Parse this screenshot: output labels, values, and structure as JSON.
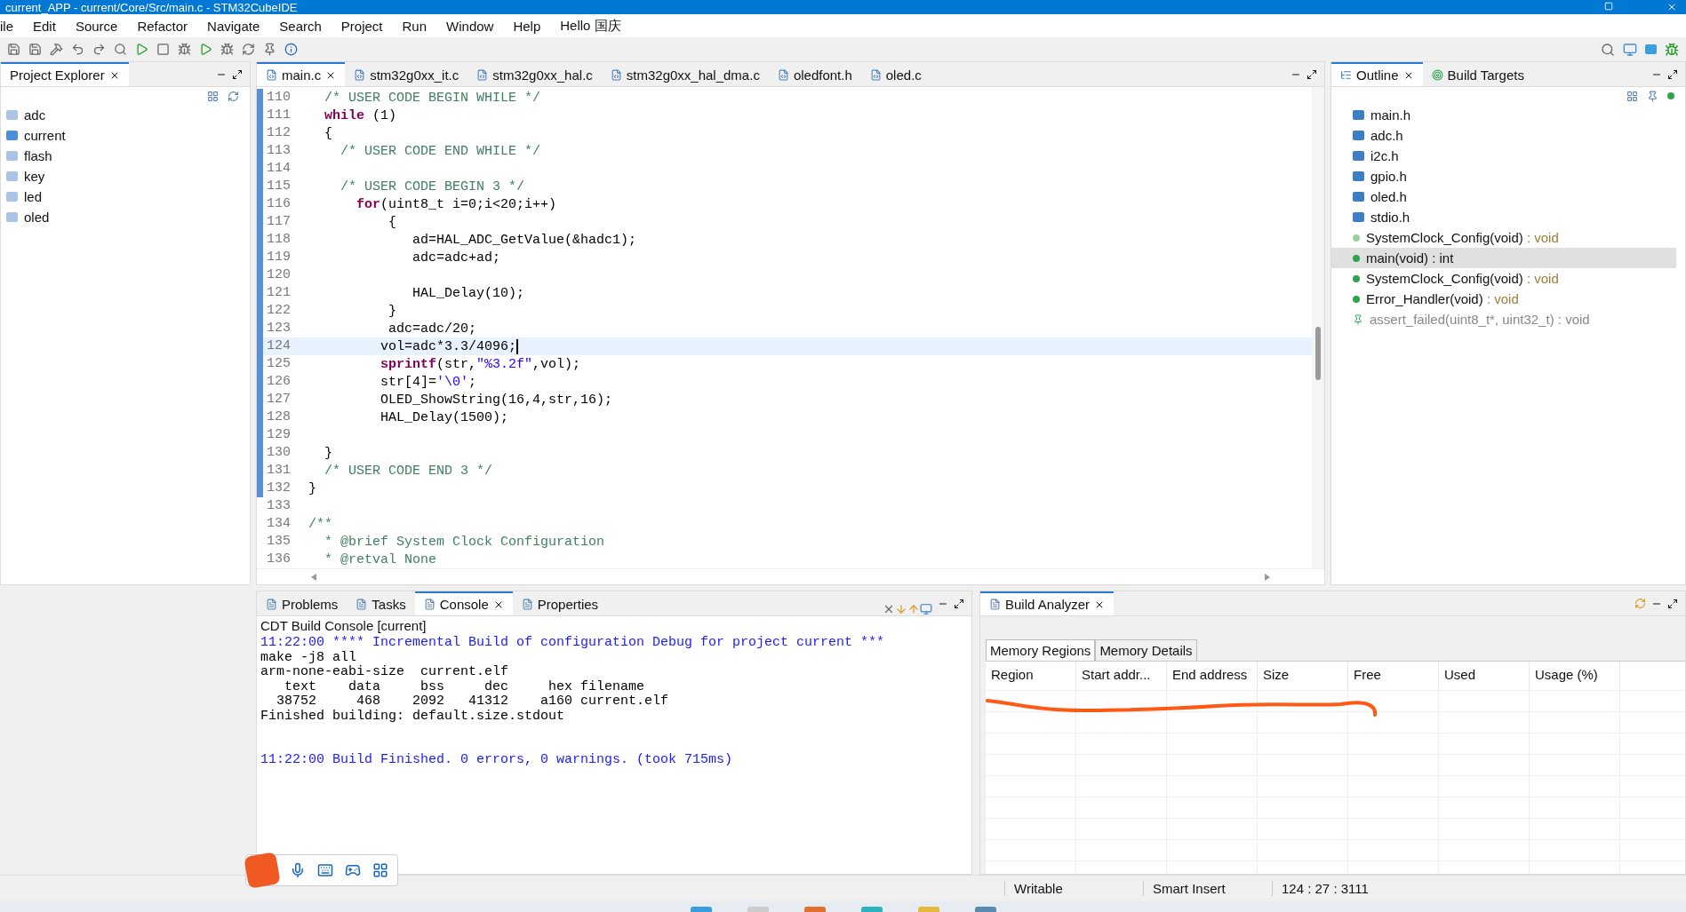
{
  "window": {
    "title": "current_APP - current/Core/Src/main.c - STM32CubeIDE"
  },
  "menu": [
    "ile",
    "Edit",
    "Source",
    "Refactor",
    "Navigate",
    "Search",
    "Project",
    "Run",
    "Window",
    "Help"
  ],
  "user_menu": "Hello 国庆",
  "project_explorer": {
    "title": "Project Explorer",
    "items": [
      {
        "label": "adc",
        "kind": "folder"
      },
      {
        "label": "current",
        "kind": "ide"
      },
      {
        "label": "flash",
        "kind": "folder"
      },
      {
        "label": "key",
        "kind": "folder"
      },
      {
        "label": "led",
        "kind": "folder"
      },
      {
        "label": "oled",
        "kind": "folder"
      }
    ]
  },
  "editor": {
    "tabs": [
      {
        "label": "main.c",
        "selected": true
      },
      {
        "label": "stm32g0xx_it.c",
        "selected": false
      },
      {
        "label": "stm32g0xx_hal.c",
        "selected": false
      },
      {
        "label": "stm32g0xx_hal_dma.c",
        "selected": false
      },
      {
        "label": "oledfont.h",
        "selected": false
      },
      {
        "label": "oled.c",
        "selected": false
      }
    ],
    "lines": [
      {
        "number": "110",
        "current": false,
        "parts": [
          {
            "kind": "comment",
            "text": "  /* USER CODE BEGIN WHILE */"
          }
        ]
      },
      {
        "number": "111",
        "current": false,
        "parts": [
          {
            "kind": "keyword",
            "text": "  while"
          },
          {
            "kind": "plain",
            "text": " (1)"
          }
        ]
      },
      {
        "number": "112",
        "current": false,
        "parts": [
          {
            "kind": "plain",
            "text": "  {"
          }
        ]
      },
      {
        "number": "113",
        "current": false,
        "parts": [
          {
            "kind": "comment",
            "text": "    /* USER CODE END WHILE */"
          }
        ]
      },
      {
        "number": "114",
        "current": false
      },
      {
        "number": "115",
        "current": false,
        "parts": [
          {
            "kind": "comment",
            "text": "    /* USER CODE BEGIN 3 */"
          }
        ]
      },
      {
        "number": "116",
        "current": false,
        "parts": [
          {
            "kind": "keyword",
            "text": "      for"
          },
          {
            "kind": "plain",
            "text": "(uint8_t i=0;i<20;i++)"
          }
        ]
      },
      {
        "number": "117",
        "current": false,
        "parts": [
          {
            "kind": "plain",
            "text": "          {"
          }
        ]
      },
      {
        "number": "118",
        "current": false,
        "parts": [
          {
            "kind": "plain",
            "text": "             ad=HAL_ADC_GetValue(&hadc1);"
          }
        ]
      },
      {
        "number": "119",
        "current": false,
        "parts": [
          {
            "kind": "plain",
            "text": "             adc=adc+ad;"
          }
        ]
      },
      {
        "number": "120",
        "current": false
      },
      {
        "number": "121",
        "current": false,
        "parts": [
          {
            "kind": "plain",
            "text": "             HAL_Delay(10);"
          }
        ]
      },
      {
        "number": "122",
        "current": false,
        "parts": [
          {
            "kind": "plain",
            "text": "          }"
          }
        ]
      },
      {
        "number": "123",
        "current": false,
        "parts": [
          {
            "kind": "plain",
            "text": "          adc=adc/20;"
          }
        ]
      },
      {
        "number": "124",
        "current": true,
        "parts": [
          {
            "kind": "plain",
            "text": "         vol=adc*3.3/4096;"
          }
        ]
      },
      {
        "number": "125",
        "current": false,
        "parts": [
          {
            "kind": "keyword",
            "text": "         sprintf"
          },
          {
            "kind": "plain",
            "text": "(str,"
          },
          {
            "kind": "string",
            "text": "\"%3.2f\""
          },
          {
            "kind": "plain",
            "text": ",vol);"
          }
        ]
      },
      {
        "number": "126",
        "current": false,
        "parts": [
          {
            "kind": "plain",
            "text": "         str[4]="
          },
          {
            "kind": "string",
            "text": "'\\0'"
          },
          {
            "kind": "plain",
            "text": ";"
          }
        ]
      },
      {
        "number": "127",
        "current": false,
        "parts": [
          {
            "kind": "plain",
            "text": "         OLED_ShowString(16,4,str,16);"
          }
        ]
      },
      {
        "number": "128",
        "current": false,
        "parts": [
          {
            "kind": "plain",
            "text": "         HAL_Delay(1500);"
          }
        ]
      },
      {
        "number": "129",
        "current": false
      },
      {
        "number": "130",
        "current": false,
        "parts": [
          {
            "kind": "plain",
            "text": "  }"
          }
        ]
      },
      {
        "number": "131",
        "current": false,
        "parts": [
          {
            "kind": "comment",
            "text": "  /* USER CODE END 3 */"
          }
        ]
      },
      {
        "number": "132",
        "current": false,
        "parts": [
          {
            "kind": "plain",
            "text": "}"
          }
        ]
      },
      {
        "number": "133",
        "current": false
      },
      {
        "number": "134",
        "current": false,
        "parts": [
          {
            "kind": "comment",
            "text": "/**"
          }
        ]
      },
      {
        "number": "135",
        "current": false,
        "parts": [
          {
            "kind": "comment",
            "text": "  * @brief System Clock Configuration"
          }
        ]
      },
      {
        "number": "136",
        "current": false,
        "parts": [
          {
            "kind": "comment",
            "text": "  * @retval None"
          }
        ]
      }
    ]
  },
  "outline": {
    "tabs": [
      {
        "label": "Outline",
        "selected": true
      },
      {
        "label": "Build Targets",
        "selected": false
      }
    ],
    "items": [
      {
        "kind": "header",
        "name": "main.h",
        "selected": false
      },
      {
        "kind": "header",
        "name": "adc.h",
        "selected": false
      },
      {
        "kind": "header",
        "name": "i2c.h",
        "selected": false
      },
      {
        "kind": "header",
        "name": "gpio.h",
        "selected": false
      },
      {
        "kind": "header",
        "name": "oled.h",
        "selected": false
      },
      {
        "kind": "header",
        "name": "stdio.h",
        "selected": false
      },
      {
        "kind": "declaration",
        "name": "SystemClock_Config(void)",
        "type": " : void",
        "selected": false
      },
      {
        "kind": "function",
        "name": "main(void) : int",
        "selected": true
      },
      {
        "kind": "function",
        "name": "SystemClock_Config(void)",
        "type": " : void",
        "selected": false
      },
      {
        "kind": "function",
        "name": "Error_Handler(void)",
        "type": " : void",
        "selected": false
      },
      {
        "kind": "hidden",
        "name": "assert_failed(uint8_t*, uint32_t) : void",
        "selected": false
      }
    ]
  },
  "console": {
    "tabs": [
      {
        "label": "Problems",
        "selected": false
      },
      {
        "label": "Tasks",
        "selected": false
      },
      {
        "label": "Console",
        "selected": true
      },
      {
        "label": "Properties",
        "selected": false
      }
    ],
    "title": "CDT Build Console [current]",
    "lines": [
      {
        "kind": "info",
        "text": "11:22:00 **** Incremental Build of configuration Debug for project current ***"
      },
      {
        "kind": "output",
        "text": "make -j8 all"
      },
      {
        "kind": "output",
        "text": "arm-none-eabi-size  current.elf"
      },
      {
        "kind": "output",
        "text": "   text    data     bss     dec     hex filename"
      },
      {
        "kind": "output",
        "text": "  38752     468    2092   41312    a160 current.elf"
      },
      {
        "kind": "output",
        "text": "Finished building: default.size.stdout"
      },
      {
        "kind": "blank"
      },
      {
        "kind": "blank"
      },
      {
        "kind": "info",
        "text": "11:22:00 Build Finished. 0 errors, 0 warnings. (took 715ms)"
      }
    ]
  },
  "build_analyzer": {
    "title": "Build Analyzer",
    "tabs": [
      {
        "label": "Memory Regions",
        "selected": true
      },
      {
        "label": "Memory Details",
        "selected": false
      }
    ],
    "columns": [
      "Region",
      "Start addr...",
      "End address",
      "Size",
      "Free",
      "Used",
      "Usage (%)"
    ]
  },
  "status_bar": [
    "Writable",
    "Smart Insert",
    "124 : 27 : 3111"
  ]
}
